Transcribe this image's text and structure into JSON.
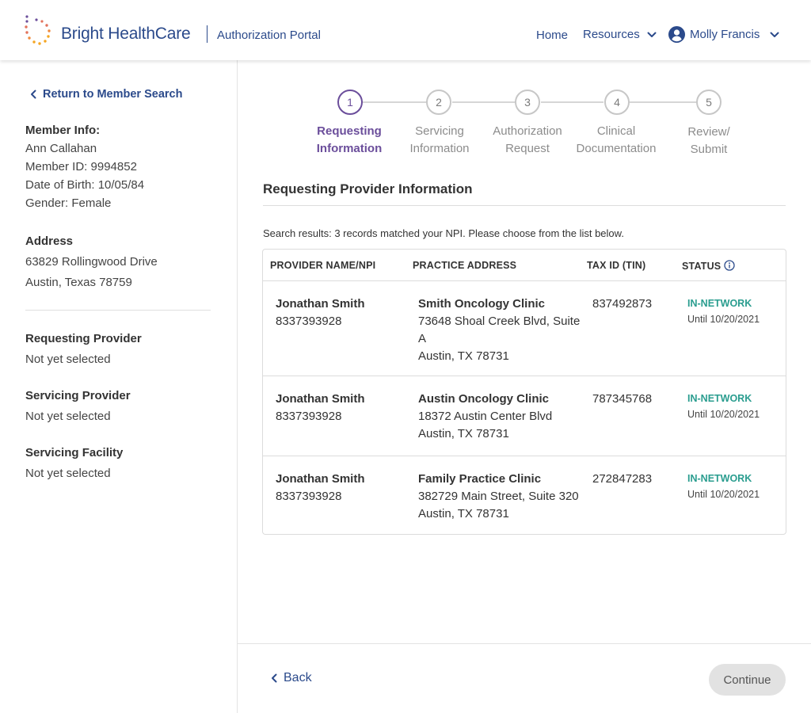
{
  "header": {
    "brand": "Bright HealthCare",
    "portal": "Authorization Portal",
    "nav": {
      "home": "Home",
      "resources": "Resources",
      "user": "Molly Francis"
    }
  },
  "sidebar": {
    "return_link": "Return to Member Search",
    "member_info_label": "Member Info:",
    "member_name": "Ann Callahan",
    "member_id": "Member ID: 9994852",
    "dob": "Date of Birth: 10/05/84",
    "gender": "Gender: Female",
    "address_label": "Address",
    "address_line1": "63829 Rollingwood Drive",
    "address_line2": "Austin, Texas 78759",
    "requesting_provider_label": "Requesting Provider",
    "requesting_provider_value": "Not yet selected",
    "servicing_provider_label": "Servicing Provider",
    "servicing_provider_value": "Not yet selected",
    "servicing_facility_label": "Servicing Facility",
    "servicing_facility_value": "Not yet selected"
  },
  "stepper": {
    "steps": [
      {
        "number": "1",
        "line1": "Requesting",
        "line2": "Information",
        "active": true
      },
      {
        "number": "2",
        "line1": "Servicing",
        "line2": "Information",
        "active": false
      },
      {
        "number": "3",
        "line1": "Authorization",
        "line2": "Request",
        "active": false
      },
      {
        "number": "4",
        "line1": "Clinical",
        "line2": "Documentation",
        "active": false
      },
      {
        "number": "5",
        "line1": "Review/",
        "line2": "Submit",
        "active": false
      }
    ]
  },
  "main": {
    "section_title": "Requesting Provider Information",
    "results_text": "Search results: 3 records matched your NPI. Please choose from the list below.",
    "table": {
      "headers": [
        "PROVIDER NAME/NPI",
        "PRACTICE ADDRESS",
        "TAX ID (TIN)",
        "STATUS"
      ],
      "rows": [
        {
          "name": "Jonathan Smith",
          "npi": "8337393928",
          "clinic": "Smith Oncology Clinic",
          "street": "73648 Shoal Creek Blvd, Suite A",
          "city": "Austin, TX 78731",
          "tin": "837492873",
          "status": "IN-NETWORK",
          "until": "Until 10/20/2021"
        },
        {
          "name": "Jonathan Smith",
          "npi": "8337393928",
          "clinic": "Austin Oncology Clinic",
          "street": "18372 Austin Center Blvd",
          "city": "Austin, TX 78731",
          "tin": "787345768",
          "status": "IN-NETWORK",
          "until": "Until 10/20/2021"
        },
        {
          "name": "Jonathan Smith",
          "npi": "8337393928",
          "clinic": "Family Practice Clinic",
          "street": "382729 Main Street, Suite 320",
          "city": "Austin, TX 78731",
          "tin": "272847283",
          "status": "IN-NETWORK",
          "until": "Until 10/20/2021"
        }
      ]
    }
  },
  "footer": {
    "back": "Back",
    "continue": "Continue"
  },
  "colors": {
    "brand_blue": "#2b4a8b",
    "active_purple": "#6b4e9b",
    "in_network_teal": "#2a9d8f"
  },
  "icons": [
    "logo-dots-icon",
    "chevron-down-icon",
    "user-circle-icon",
    "chevron-left-icon",
    "info-icon"
  ]
}
